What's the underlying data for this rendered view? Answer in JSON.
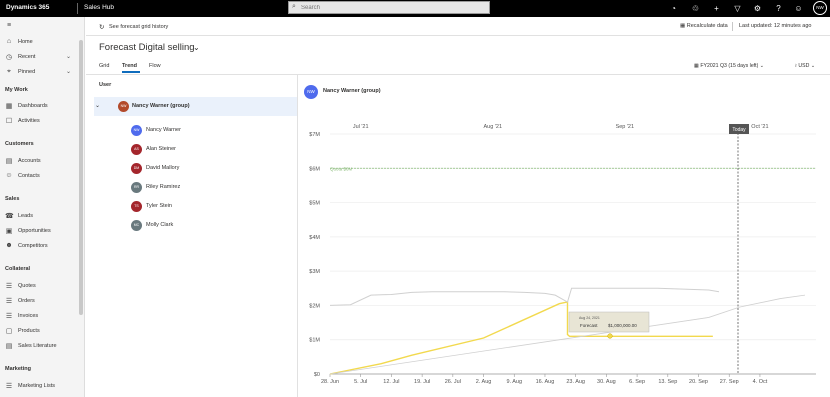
{
  "topbar": {
    "brand": "Dynamics 365",
    "app_name": "Sales Hub",
    "search_placeholder": "Search",
    "icons": [
      "assistant-icon",
      "lightbulb-icon",
      "plus-icon",
      "filter-icon",
      "settings-icon",
      "help-icon",
      "people-icon"
    ],
    "avatar_initials": "NW"
  },
  "sidebar": {
    "top_items": [
      {
        "label": "Home",
        "icon": "home-icon"
      },
      {
        "label": "Recent",
        "icon": "clock-icon",
        "chevron": true
      },
      {
        "label": "Pinned",
        "icon": "pin-icon",
        "chevron": true
      }
    ],
    "sections": [
      {
        "title": "My Work",
        "items": [
          {
            "label": "Dashboards",
            "icon": "dashboard-icon"
          },
          {
            "label": "Activities",
            "icon": "activities-icon"
          }
        ]
      },
      {
        "title": "Customers",
        "items": [
          {
            "label": "Accounts",
            "icon": "accounts-icon"
          },
          {
            "label": "Contacts",
            "icon": "contacts-icon"
          }
        ]
      },
      {
        "title": "Sales",
        "items": [
          {
            "label": "Leads",
            "icon": "leads-icon"
          },
          {
            "label": "Opportunities",
            "icon": "opportunities-icon"
          },
          {
            "label": "Competitors",
            "icon": "competitors-icon"
          }
        ]
      },
      {
        "title": "Collateral",
        "items": [
          {
            "label": "Quotes",
            "icon": "quotes-icon"
          },
          {
            "label": "Orders",
            "icon": "orders-icon"
          },
          {
            "label": "Invoices",
            "icon": "invoices-icon"
          },
          {
            "label": "Products",
            "icon": "products-icon"
          },
          {
            "label": "Sales Literature",
            "icon": "literature-icon"
          }
        ]
      },
      {
        "title": "Marketing",
        "items": [
          {
            "label": "Marketing Lists",
            "icon": "lists-icon"
          }
        ]
      }
    ]
  },
  "commandbar": {
    "history_label": "See forecast grid history",
    "recalculate_label": "Recalculate data",
    "last_updated": "Last updated: 12 minutes ago"
  },
  "forecast": {
    "title": "Forecast Digital selling",
    "tabs": [
      "Grid",
      "Trend",
      "Flow"
    ],
    "active_tab": "Trend",
    "period": "FY2021 Q3 (15 days left)",
    "currency": "USD"
  },
  "left_panel": {
    "header": "User",
    "group": {
      "name": "Nancy Warner (group)",
      "initials": "NW",
      "color": "#b24a2b"
    },
    "users": [
      {
        "name": "Nancy Warner",
        "initials": "NW",
        "color": "#4f6bed"
      },
      {
        "name": "Alan Steiner",
        "initials": "AS",
        "color": "#a4262c"
      },
      {
        "name": "David Mallory",
        "initials": "DM",
        "color": "#a4262c"
      },
      {
        "name": "Riley Ramirez",
        "initials": "RR",
        "color": "#69797e"
      },
      {
        "name": "Tyler Stein",
        "initials": "TS",
        "color": "#a4262c"
      },
      {
        "name": "Molly Clark",
        "initials": "MC",
        "color": "#69797e"
      }
    ]
  },
  "chart_panel": {
    "owner_name": "Nancy Warner (group)",
    "owner_initials": "NW"
  },
  "chart_data": {
    "type": "line",
    "y_ticks": [
      "$0",
      "$1M",
      "$2M",
      "$3M",
      "$4M",
      "$5M",
      "$6M",
      "$7M"
    ],
    "ylim": [
      0,
      7000000
    ],
    "x_ticks": [
      "28. Jun",
      "5. Jul",
      "12. Jul",
      "19. Jul",
      "26. Jul",
      "2. Aug",
      "9. Aug",
      "16. Aug",
      "23. Aug",
      "30. Aug",
      "6. Sep",
      "13. Sep",
      "20. Sep",
      "27. Sep",
      "4. Oct"
    ],
    "month_labels": [
      "Jul '21",
      "Aug '21",
      "Sep '21",
      "Oct '21"
    ],
    "today_label": "Today",
    "today_date": "2021-09-15",
    "quota_label": "Quota $6M",
    "quota_value": 6000000,
    "tooltip": {
      "date": "Aug 24, 2021",
      "label": "Forecast",
      "value": "$1,000,000.00"
    },
    "colors": {
      "forecast": "#f2d94e",
      "gray_line": "#d0d0d0",
      "quota": "#8bbd7b",
      "today": "#555555"
    },
    "series": [
      {
        "points": [
          [
            0,
            0
          ],
          [
            2.5,
            0.3
          ],
          [
            4,
            0.55
          ],
          [
            7.5,
            1.05
          ],
          [
            11.2,
            2.05
          ],
          [
            11.6,
            2.1
          ],
          [
            11.6,
            1.15
          ],
          [
            11.7,
            1.1
          ],
          [
            18.7,
            1.1
          ]
        ]
      },
      {
        "points": [
          [
            0,
            2.0
          ],
          [
            1,
            2.02
          ],
          [
            2,
            2.3
          ],
          [
            3,
            2.32
          ],
          [
            4,
            2.38
          ],
          [
            5,
            2.4
          ],
          [
            8.5,
            2.4
          ],
          [
            9.5,
            2.38
          ],
          [
            10.5,
            2.35
          ],
          [
            11,
            2.3
          ],
          [
            11.6,
            2.1
          ],
          [
            11.8,
            2.5
          ],
          [
            16,
            2.5
          ],
          [
            18.5,
            2.45
          ],
          [
            19,
            2.4
          ]
        ]
      },
      {
        "points": [
          [
            0,
            0
          ],
          [
            18.5,
            1.65
          ],
          [
            20,
            1.95
          ],
          [
            22,
            2.2
          ],
          [
            23.2,
            2.3
          ]
        ]
      }
    ]
  }
}
